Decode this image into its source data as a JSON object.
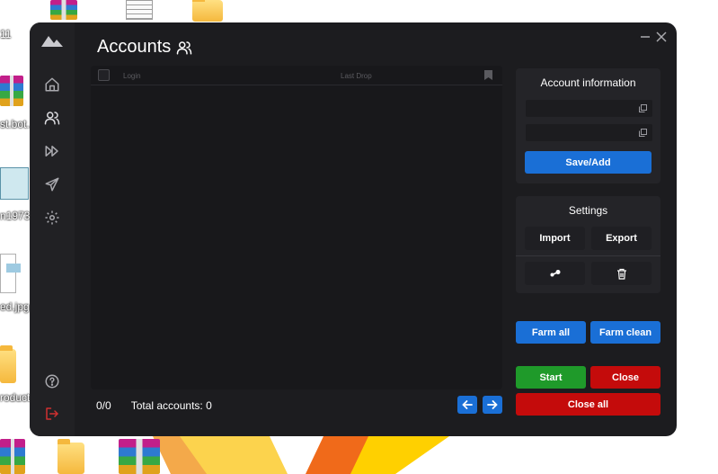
{
  "desktop": {
    "labels": [
      "11",
      "st.bot..",
      "n1973...",
      "ed.jpg",
      "roduct"
    ]
  },
  "window": {
    "title": "Accounts",
    "nav": [
      "home-icon",
      "users-icon",
      "fast-forward-icon",
      "send-icon",
      "gear-icon"
    ],
    "nav_bottom": [
      "help-icon",
      "logout-icon"
    ],
    "active_nav": "users-icon"
  },
  "table": {
    "columns": {
      "login": "Login",
      "last_drop": "Last Drop"
    },
    "rows": []
  },
  "footer": {
    "count": "0/0",
    "total": "Total accounts: 0"
  },
  "account_info": {
    "title": "Account information",
    "field1": {
      "value": "",
      "placeholder": ""
    },
    "field2": {
      "value": "",
      "placeholder": ""
    },
    "save_label": "Save/Add"
  },
  "settings": {
    "title": "Settings",
    "import_label": "Import",
    "export_label": "Export",
    "icons": [
      "steam-icon",
      "trash-icon"
    ]
  },
  "actions": {
    "farm_all": "Farm all",
    "farm_clean": "Farm clean",
    "start": "Start",
    "close": "Close",
    "close_all": "Close all"
  },
  "colors": {
    "window_bg": "#1c1c1f",
    "accent_blue": "#1a6fd6",
    "green": "#1f9a2a",
    "red": "#c40b0b",
    "logout_red": "#d03030"
  }
}
